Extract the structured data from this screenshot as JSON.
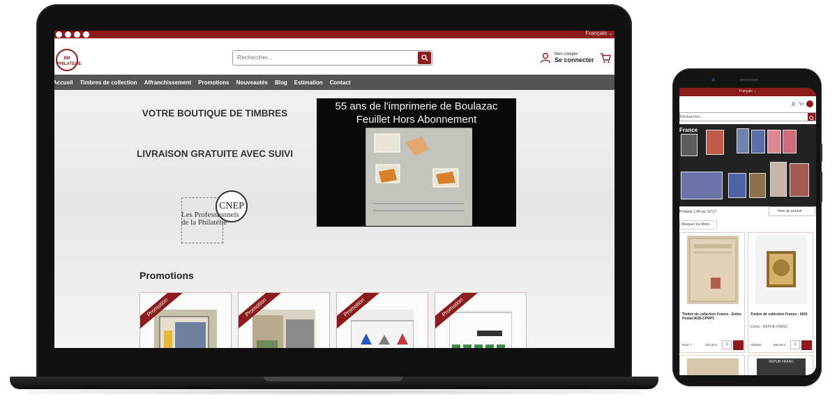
{
  "laptop": {
    "topbar": {
      "language": "Français ⌄"
    },
    "header": {
      "logo_text": "BM PHILATELIE",
      "search_placeholder": "Rechercher...",
      "account_small": "Mon compte",
      "account_label": "Se connecter"
    },
    "nav": [
      {
        "label": "Accueil"
      },
      {
        "label": "Timbres de collection"
      },
      {
        "label": "Affranchissement"
      },
      {
        "label": "Promotions"
      },
      {
        "label": "Nouveautés"
      },
      {
        "label": "Blog"
      },
      {
        "label": "Estimation"
      },
      {
        "label": "Contact"
      }
    ],
    "hero": {
      "tagline_1": "VOTRE BOUTIQUE DE TIMBRES",
      "tagline_2": "LIVRAISON GRATUITE AVEC SUIVI",
      "cnep_mark": "CNEP",
      "cnep_text": "Les Professionnels de la Philatélie",
      "video_line_1": "55 ans de l'imprimerie de Boulazac",
      "video_line_2": "Feuillet Hors Abonnement"
    },
    "promotions": {
      "title": "Promotions",
      "ribbon": "Promotion",
      "cards": [
        {
          "image": "stamp-sheet-1"
        },
        {
          "image": "stamp-sheet-2"
        },
        {
          "image": "stamp-sheet-3"
        },
        {
          "image": "stamp-sheet-4"
        }
      ]
    }
  },
  "phone": {
    "language": "Français ⌄",
    "search_placeholder": "Rechercher...",
    "banner_label": "France",
    "results": "Produits 1-48 sur 10717",
    "sort": "Nom du produit",
    "filter": "Masquer les filtres",
    "cards": [
      {
        "title": "Timbre de collection France - Entier Postal 0035-CPRP3",
        "sub": "",
        "meta": "Neuf **",
        "price": "160,00 €",
        "qty": "1"
      },
      {
        "title": "Timbre de collection France - 0001",
        "sub": "Cérès - REPUB FRANC",
        "meta": "Oblitéré",
        "price": "600,00 €",
        "qty": "1"
      }
    ],
    "card3_text": "REPUB FRANC"
  },
  "colors": {
    "brand": "#8c1c1c",
    "nav_bg": "#555555"
  }
}
